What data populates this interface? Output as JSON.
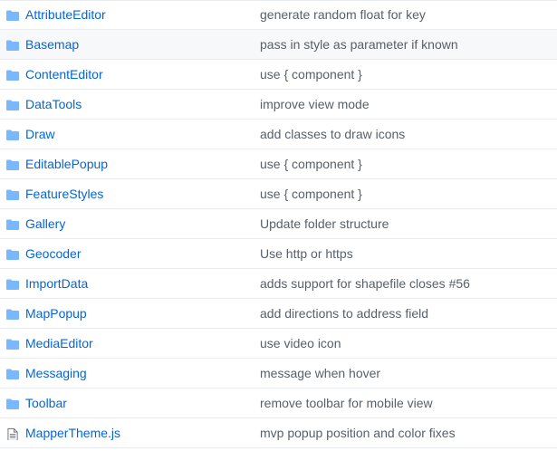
{
  "files": [
    {
      "name": "AttributeEditor",
      "type": "folder",
      "message": "generate random float for key"
    },
    {
      "name": "Basemap",
      "type": "folder",
      "message": "pass in style as parameter if known"
    },
    {
      "name": "ContentEditor",
      "type": "folder",
      "message": "use { component }"
    },
    {
      "name": "DataTools",
      "type": "folder",
      "message": "improve view mode"
    },
    {
      "name": "Draw",
      "type": "folder",
      "message": "add classes to draw icons"
    },
    {
      "name": "EditablePopup",
      "type": "folder",
      "message": "use { component }"
    },
    {
      "name": "FeatureStyles",
      "type": "folder",
      "message": "use { component }"
    },
    {
      "name": "Gallery",
      "type": "folder",
      "message": "Update folder structure"
    },
    {
      "name": "Geocoder",
      "type": "folder",
      "message": "Use http or https"
    },
    {
      "name": "ImportData",
      "type": "folder",
      "message": "adds support for shapefile closes #56"
    },
    {
      "name": "MapPopup",
      "type": "folder",
      "message": "add directions to address field"
    },
    {
      "name": "MediaEditor",
      "type": "folder",
      "message": "use video icon"
    },
    {
      "name": "Messaging",
      "type": "folder",
      "message": "message when hover"
    },
    {
      "name": "Toolbar",
      "type": "folder",
      "message": "remove toolbar for mobile view"
    },
    {
      "name": "MapperTheme.js",
      "type": "file",
      "message": "mvp popup position and color fixes"
    }
  ],
  "colors": {
    "link": "#0366d6",
    "message": "#586069",
    "folder_icon": "#79b8ff",
    "file_icon": "#6a737d",
    "row_border": "#eaecef",
    "hover_background": "#f6f8fa"
  },
  "highlighted_row": "Basemap"
}
